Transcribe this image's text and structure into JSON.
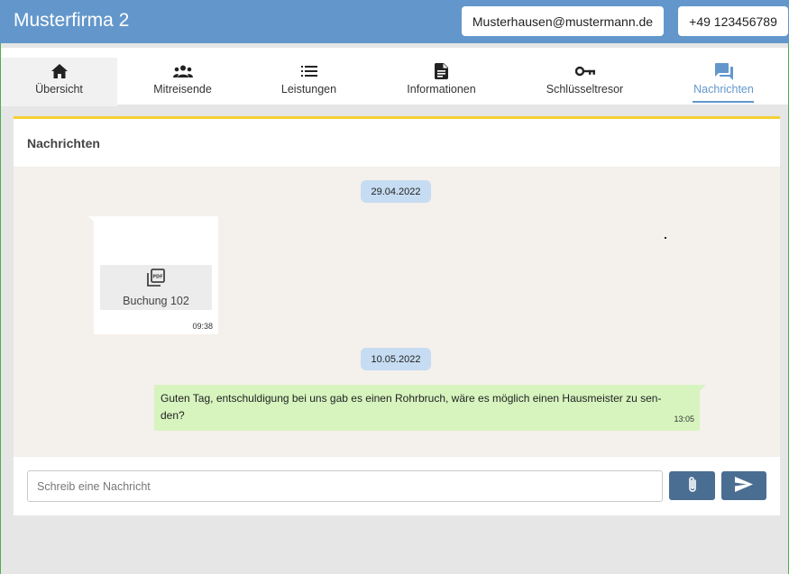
{
  "header": {
    "title": "Musterfirma 2",
    "email": "Musterhausen@mustermann.de",
    "phone": "+49 123456789"
  },
  "tabs": [
    {
      "label": "Übersicht",
      "icon": "home-icon"
    },
    {
      "label": "Mitreisende",
      "icon": "group-icon"
    },
    {
      "label": "Leistungen",
      "icon": "list-icon"
    },
    {
      "label": "Informationen",
      "icon": "document-icon"
    },
    {
      "label": "Schlüsseltresor",
      "icon": "key-icon"
    },
    {
      "label": "Nachrichten",
      "icon": "chat-icon",
      "selected": true
    }
  ],
  "panel": {
    "title": "Nachrichten"
  },
  "messages": [
    {
      "date": "29.04.2022",
      "direction": "incoming",
      "attachment": {
        "icon": "pdf-icon",
        "name": "Buchung 102"
      },
      "time": "09:38"
    },
    {
      "date": "10.05.2022",
      "direction": "outgoing",
      "text": "Guten Tag, entschuldigung bei uns gab es einen Rohrbruch, wäre es möglich einen Hausmeister zu sen-den?",
      "time": "13:05"
    }
  ],
  "composer": {
    "placeholder": "Schreib eine Nachricht",
    "value": ""
  },
  "colors": {
    "header": "#6397cb",
    "accent": "#6397cb",
    "panel_border": "#f5d033",
    "date_pill": "#c6dcf2",
    "outgoing_bubble": "#d7f4bf",
    "button": "#4a6e92"
  }
}
